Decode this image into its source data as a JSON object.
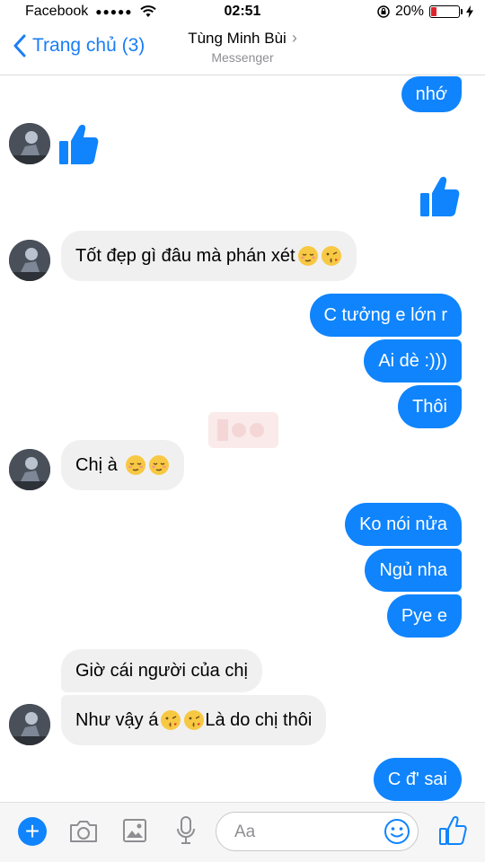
{
  "status_bar": {
    "carrier": "Facebook",
    "signal": "●●●●●",
    "time": "02:51",
    "battery": "20%",
    "battery_level": 0.2
  },
  "nav": {
    "back_label": "Trang chủ (3)",
    "title": "Tùng Minh Bùi",
    "subtitle": "Messenger"
  },
  "messages": [
    {
      "dir": "out",
      "text": "nhớ"
    },
    {
      "dir": "in",
      "kind": "like"
    },
    {
      "dir": "out",
      "kind": "like"
    },
    {
      "dir": "in",
      "text": "Tốt đẹp gì đâu mà phán xét",
      "emoji": [
        "relieved-emoji",
        "kiss-emoji"
      ]
    },
    {
      "dir": "out",
      "text": "C tưởng e lớn r"
    },
    {
      "dir": "out",
      "text": "Ai dè :)))"
    },
    {
      "dir": "out",
      "text": "Thôi"
    },
    {
      "dir": "in",
      "text": "Chị à",
      "emoji": [
        "relieved-emoji",
        "relieved-emoji"
      ]
    },
    {
      "dir": "out",
      "text": "Ko nói nửa"
    },
    {
      "dir": "out",
      "text": "Ngủ nha"
    },
    {
      "dir": "out",
      "text": "Pye e"
    },
    {
      "dir": "in",
      "text": "Giờ cái người của chị"
    },
    {
      "dir": "in",
      "text": "Như vậy á",
      "after_emoji": "Là do chị thôi",
      "emoji": [
        "kiss-emoji",
        "kiss-emoji"
      ]
    },
    {
      "dir": "out",
      "text": "C đ' sai"
    }
  ],
  "composer": {
    "placeholder": "Aa"
  },
  "colors": {
    "accent": "#0f84fd",
    "incoming_bubble": "#f1f0f0",
    "battery_low": "#e0242a"
  }
}
